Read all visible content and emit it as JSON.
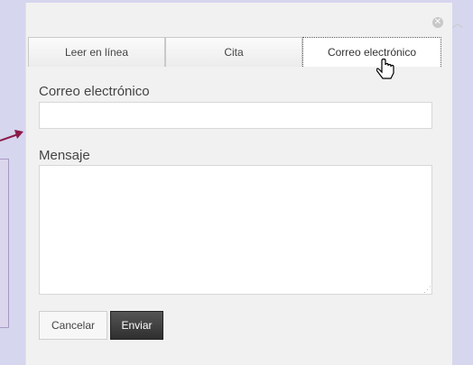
{
  "dialog": {
    "close_icon": "close-icon",
    "tabs": [
      {
        "label": "Leer en línea",
        "active": false
      },
      {
        "label": "Cita",
        "active": false
      },
      {
        "label": "Correo electrónico",
        "active": true
      }
    ],
    "form": {
      "email_label": "Correo electrónico",
      "email_value": "",
      "message_label": "Mensaje",
      "message_value": "",
      "cancel_label": "Cancelar",
      "send_label": "Enviar"
    }
  },
  "colors": {
    "background": "#d6d6ee",
    "arrow": "#8b1a4a",
    "send_button": "#3a3a3a"
  }
}
